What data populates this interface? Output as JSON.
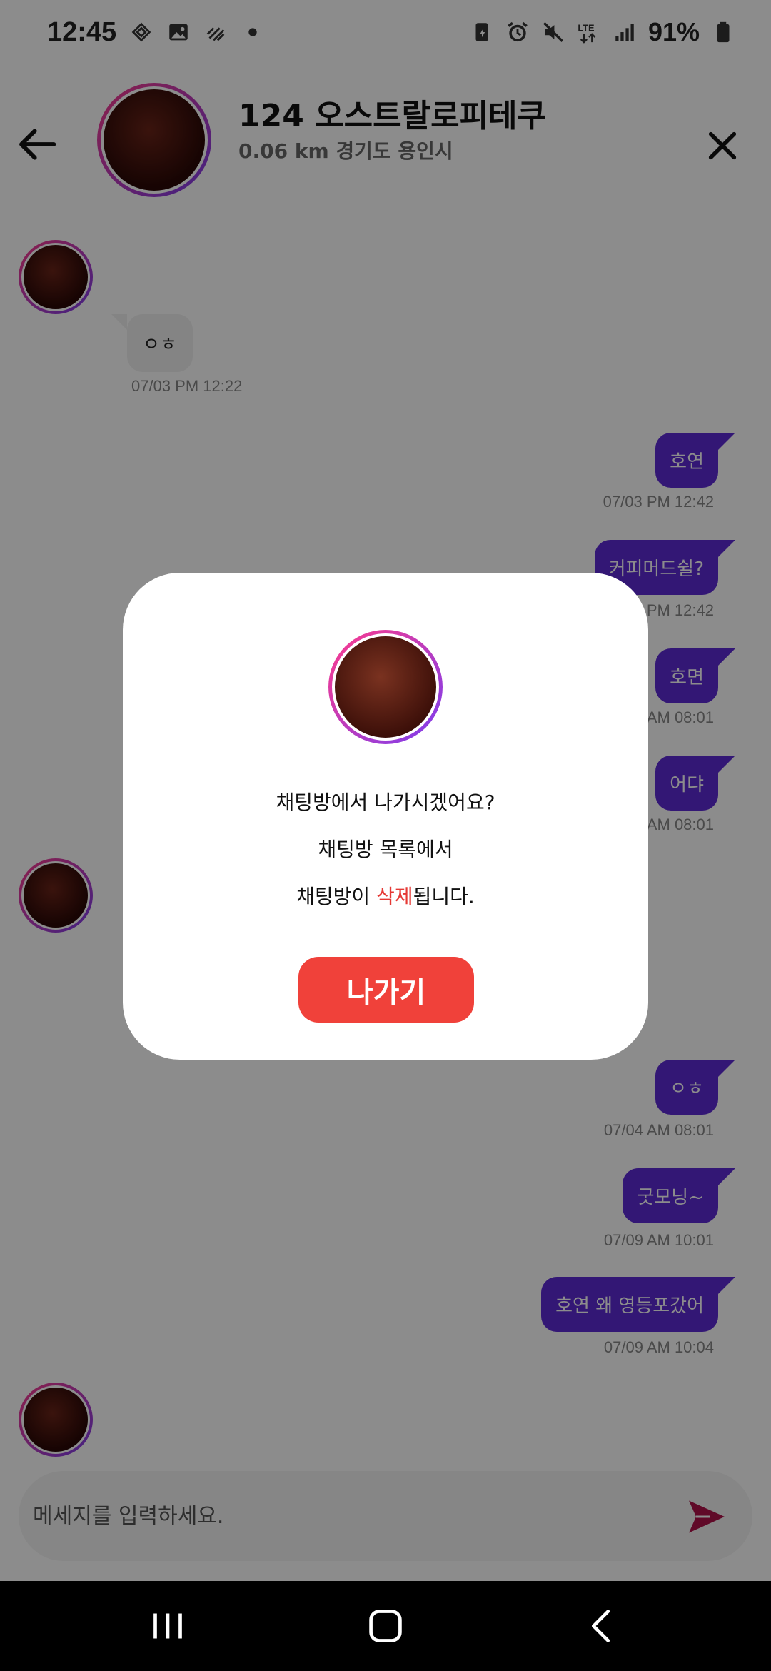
{
  "status_bar": {
    "time": "12:45",
    "battery": "91%",
    "icons": [
      "sync-icon",
      "image-icon",
      "pattern-icon",
      "dot-icon",
      "battery-saver-icon",
      "alarm-icon",
      "mute-icon",
      "lte-icon",
      "signal-icon",
      "battery-icon"
    ]
  },
  "header": {
    "title": "124 오스트랄로피테쿠",
    "subtitle": "0.06 km 경기도 용인시"
  },
  "messages": [
    {
      "side": "in",
      "text": "ㅇㅎ",
      "time": "07/03 PM 12:22"
    },
    {
      "side": "out",
      "text": "호연",
      "time": "07/03 PM 12:42"
    },
    {
      "side": "out",
      "text": "커피머드쉴?",
      "time": "07/03 PM 12:42"
    },
    {
      "side": "out",
      "text": "호면",
      "time": "07/04 AM 08:01"
    },
    {
      "side": "out",
      "text": "어댜",
      "time": "07/04 AM 08:01"
    },
    {
      "side": "out",
      "text": "ㅇㅎ",
      "time": "07/04 AM 08:01"
    },
    {
      "side": "out",
      "text": "굿모닝~",
      "time": "07/09 AM 10:01"
    },
    {
      "side": "out",
      "text": "호연 왜 영등포갔어",
      "time": "07/09 AM 10:04"
    }
  ],
  "input": {
    "placeholder": "메세지를 입력하세요."
  },
  "dialog": {
    "line1": "채팅방에서 나가시겠어요?",
    "line2": "채팅방 목록에서",
    "line3_before": "채팅방이 ",
    "line3_highlight": "삭제",
    "line3_after": "됩니다.",
    "exit_label": "나가기"
  },
  "colors": {
    "accent": "#5d2ad6",
    "exit_button": "#f0413a",
    "highlight": "#e53935",
    "send_icon": "#b0124a"
  }
}
